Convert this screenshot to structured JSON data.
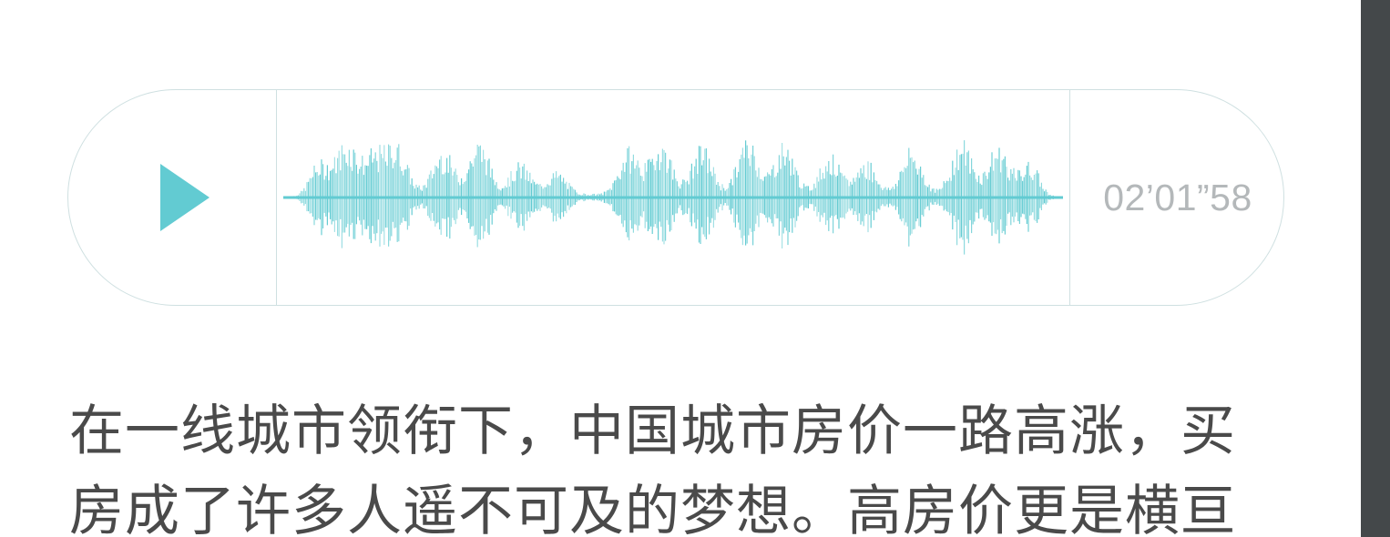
{
  "audio_player": {
    "duration": "02’01”58",
    "play_icon": "play-triangle",
    "accent_color": "#62cbd2",
    "border_color": "#cfe0e1",
    "progress": 0
  },
  "article": {
    "paragraph": "在一线城市领衔下，中国城市房价一路高涨，买房成了许多人遥不可及的梦想。高房价更是横亘"
  },
  "colors": {
    "text": "#4a4a4a",
    "duration_text": "#b4b8ba",
    "scrollbar": "#44484a"
  }
}
